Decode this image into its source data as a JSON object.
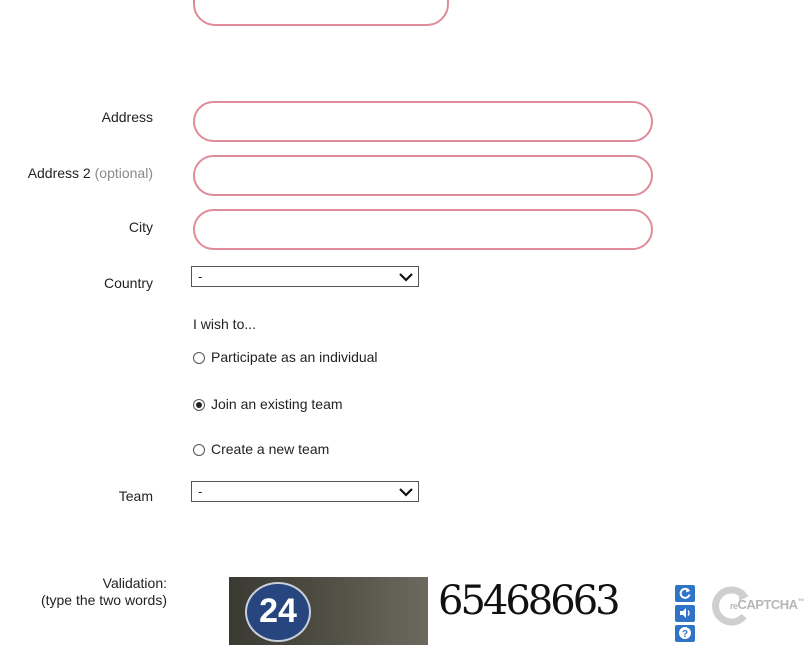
{
  "form": {
    "address_label": "Address",
    "address2_label": "Address 2",
    "address2_optional": "(optional)",
    "city_label": "City",
    "country_label": "Country",
    "country_value": "-",
    "wish_heading": "I wish to...",
    "options": [
      {
        "label": "Participate as an individual",
        "selected": false
      },
      {
        "label": "Join an existing team",
        "selected": true
      },
      {
        "label": "Create a new team",
        "selected": false
      }
    ],
    "team_label": "Team",
    "team_value": "-"
  },
  "captcha": {
    "label_line1": "Validation:",
    "label_line2": "(type the two words)",
    "photo_text": "24",
    "word_text": "65468663",
    "brand_prefix": "re",
    "brand_name": "CAPTCHA",
    "brand_tm": "™",
    "refresh_icon": "refresh-icon",
    "audio_icon": "audio-icon",
    "help_icon": "help-icon"
  },
  "colors": {
    "field_border": "#e08b99",
    "captcha_button": "#2f74c6"
  }
}
